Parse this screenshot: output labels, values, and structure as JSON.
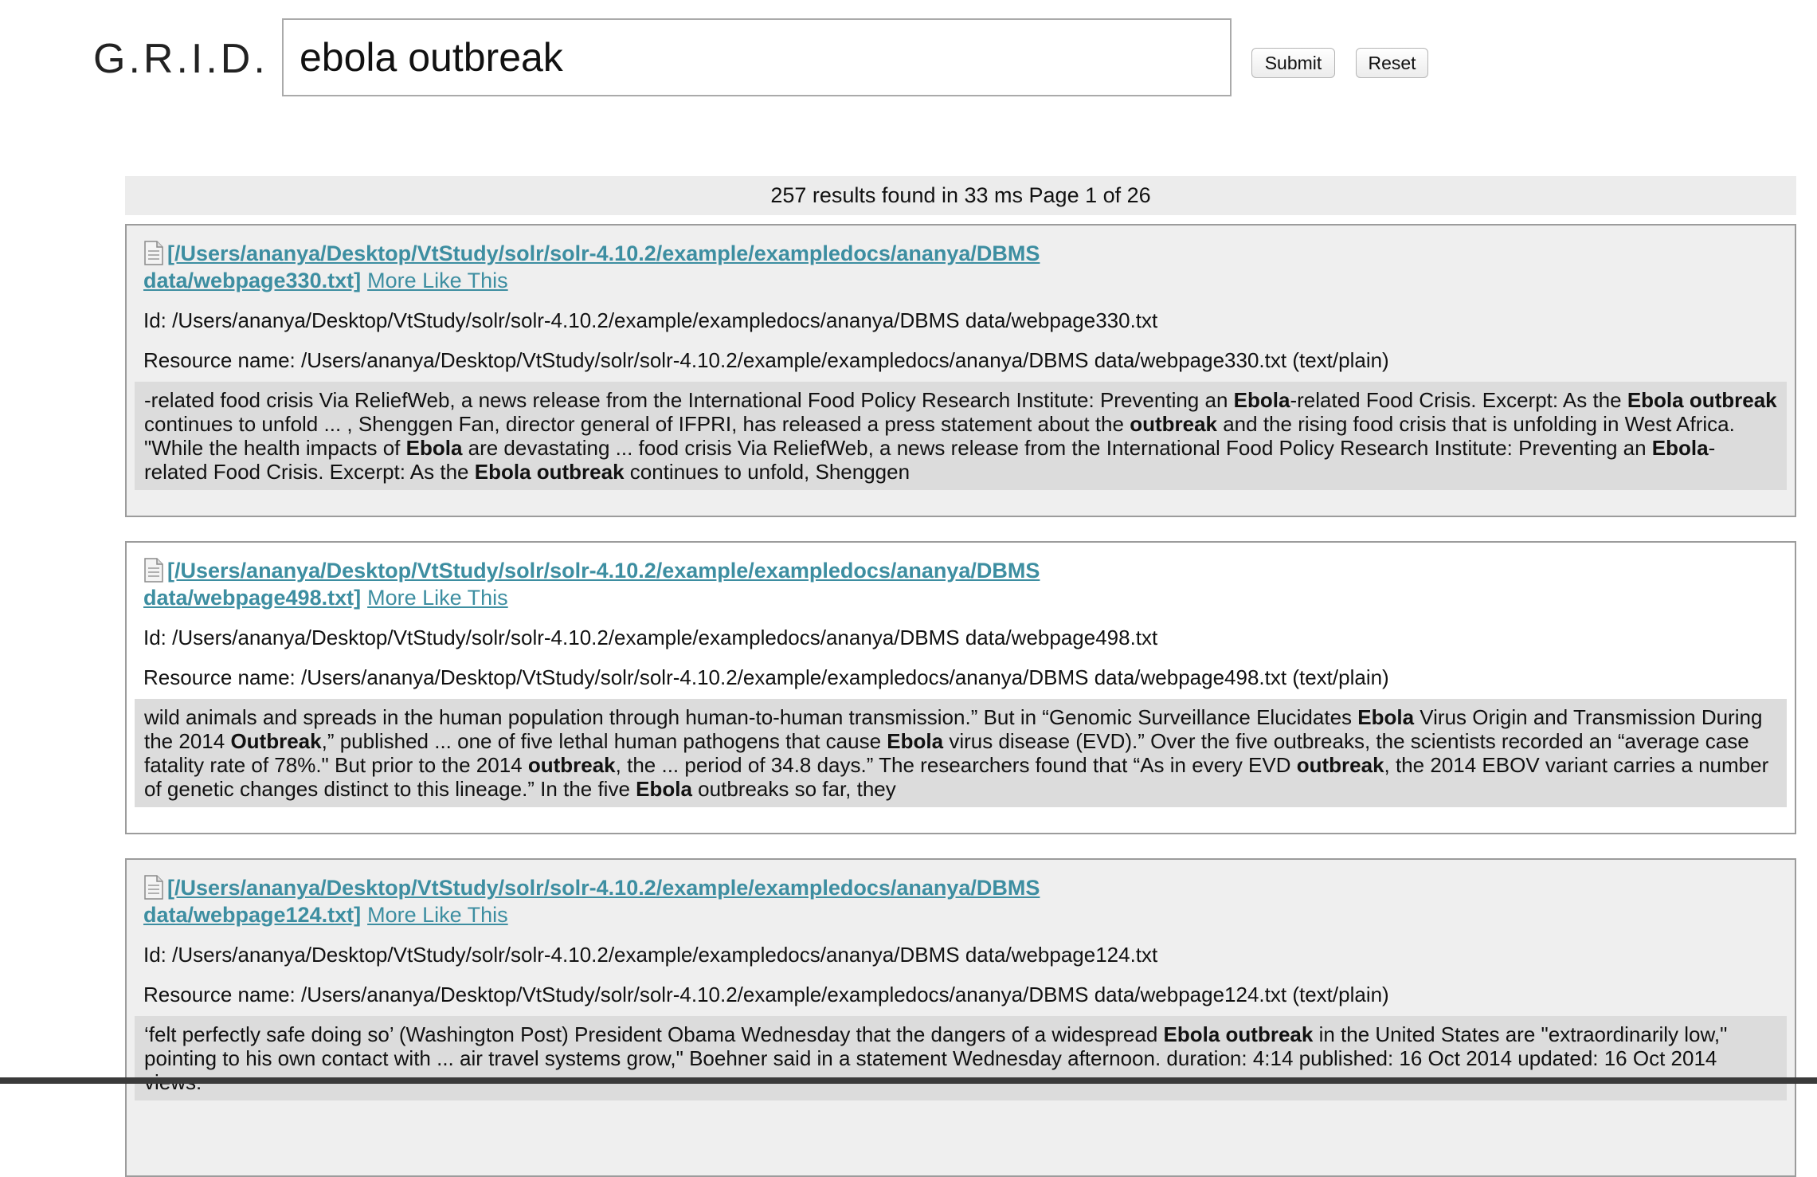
{
  "header": {
    "logo": "G.R.I.D.",
    "search_value": "ebola outbreak",
    "submit_label": "Submit",
    "reset_label": "Reset"
  },
  "summary": "257 results found in 33 ms Page 1 of 26",
  "icons": {
    "document": "document-icon"
  },
  "results": [
    {
      "link_text": "[/Users/ananya/Desktop/VtStudy/solr/solr-4.10.2/example/exampledocs/ananya/DBMS data/webpage330.txt]",
      "more_like_this": "More Like This",
      "id": "Id: /Users/ananya/Desktop/VtStudy/solr/solr-4.10.2/example/exampledocs/ananya/DBMS data/webpage330.txt",
      "resource": "Resource name: /Users/ananya/Desktop/VtStudy/solr/solr-4.10.2/example/exampledocs/ananya/DBMS data/webpage330.txt (text/plain)",
      "snippet": [
        {
          "t": "-related food crisis Via ReliefWeb, a news release from the International Food Policy Research Institute: Preventing an "
        },
        {
          "t": "Ebola",
          "b": true
        },
        {
          "t": "-related Food Crisis. Excerpt: As the "
        },
        {
          "t": "Ebola outbreak",
          "b": true
        },
        {
          "t": " continues to unfold ... , Shenggen Fan, director general of IFPRI, has released a press statement about the "
        },
        {
          "t": "outbreak",
          "b": true
        },
        {
          "t": " and the rising food crisis that is unfolding in West Africa. \"While the health impacts of "
        },
        {
          "t": "Ebola",
          "b": true
        },
        {
          "t": " are devastating ... food crisis Via ReliefWeb, a news release from the International Food Policy Research Institute: Preventing an "
        },
        {
          "t": "Ebola",
          "b": true
        },
        {
          "t": "-related Food Crisis. Excerpt: As the "
        },
        {
          "t": "Ebola outbreak",
          "b": true
        },
        {
          "t": " continues to unfold, Shenggen"
        }
      ]
    },
    {
      "link_text": "[/Users/ananya/Desktop/VtStudy/solr/solr-4.10.2/example/exampledocs/ananya/DBMS data/webpage498.txt]",
      "more_like_this": "More Like This",
      "id": "Id: /Users/ananya/Desktop/VtStudy/solr/solr-4.10.2/example/exampledocs/ananya/DBMS data/webpage498.txt",
      "resource": "Resource name: /Users/ananya/Desktop/VtStudy/solr/solr-4.10.2/example/exampledocs/ananya/DBMS data/webpage498.txt (text/plain)",
      "snippet": [
        {
          "t": "wild animals and spreads in the human population through human-to-human transmission.”  But in “Genomic Surveillance Elucidates "
        },
        {
          "t": "Ebola",
          "b": true
        },
        {
          "t": " Virus Origin and Transmission During the 2014 "
        },
        {
          "t": "Outbreak",
          "b": true
        },
        {
          "t": ",” published ... one of five lethal human pathogens that cause "
        },
        {
          "t": "Ebola",
          "b": true
        },
        {
          "t": " virus disease (EVD).” Over the five outbreaks, the scientists recorded an “average case fatality rate of 78%.\" But prior to the 2014 "
        },
        {
          "t": "outbreak",
          "b": true
        },
        {
          "t": ", the ... period of 34.8 days.” The researchers found that “As in every EVD "
        },
        {
          "t": "outbreak",
          "b": true
        },
        {
          "t": ", the 2014 EBOV variant carries a number of genetic changes distinct to this lineage.” In the five "
        },
        {
          "t": "Ebola",
          "b": true
        },
        {
          "t": " outbreaks so far, they"
        }
      ]
    },
    {
      "link_text": "[/Users/ananya/Desktop/VtStudy/solr/solr-4.10.2/example/exampledocs/ananya/DBMS data/webpage124.txt]",
      "more_like_this": "More Like This",
      "id": "Id: /Users/ananya/Desktop/VtStudy/solr/solr-4.10.2/example/exampledocs/ananya/DBMS data/webpage124.txt",
      "resource": "Resource name: /Users/ananya/Desktop/VtStudy/solr/solr-4.10.2/example/exampledocs/ananya/DBMS data/webpage124.txt (text/plain)",
      "snippet": [
        {
          "t": "‘felt perfectly safe doing so’ (Washington Post) President Obama Wednesday that the dangers of a widespread "
        },
        {
          "t": "Ebola outbreak",
          "b": true
        },
        {
          "t": " in the United States are \"extraordinarily low,\" pointing to his own contact with ... air travel systems grow,\" Boehner said in a statement Wednesday afternoon. duration: 4:14 published: 16 Oct 2014 updated: 16 Oct 2014 views: "
        }
      ]
    }
  ]
}
